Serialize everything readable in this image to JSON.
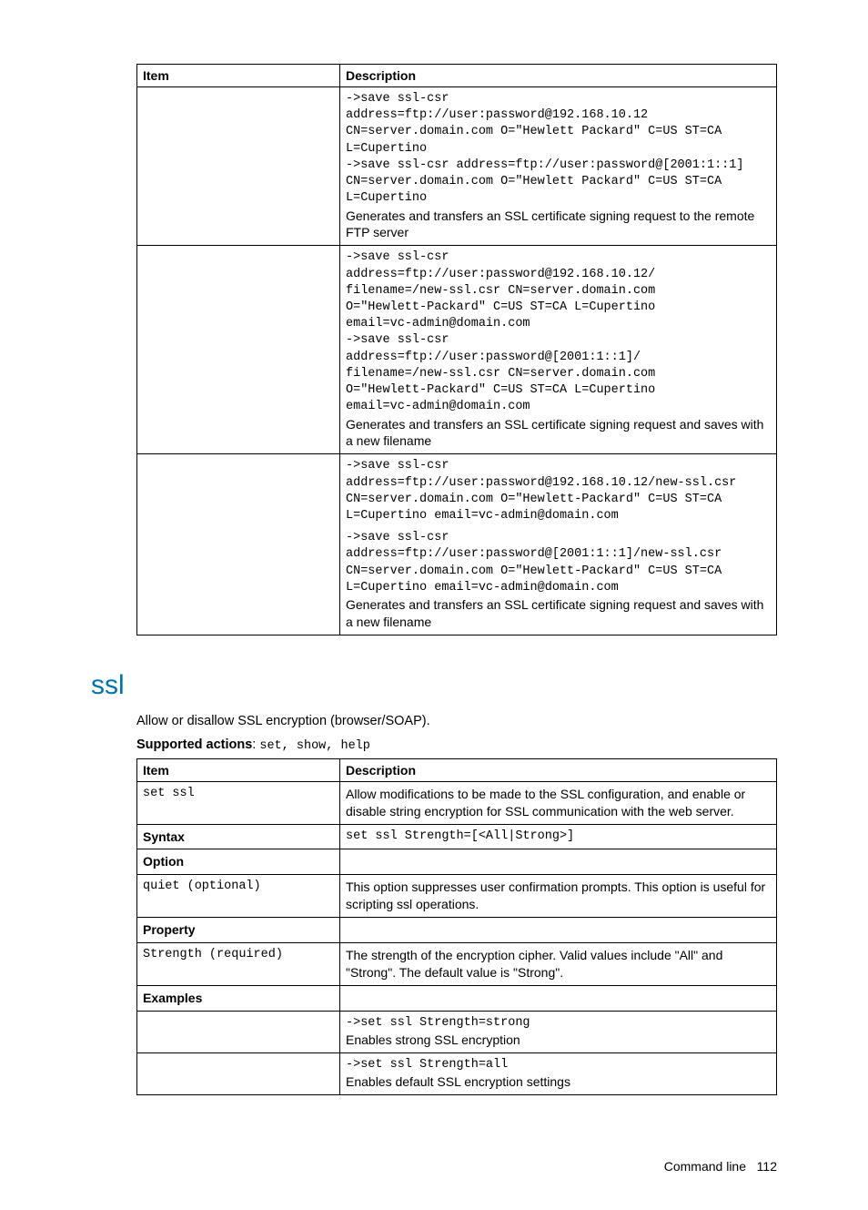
{
  "table1": {
    "headers": {
      "item": "Item",
      "desc": "Description"
    },
    "rows": [
      {
        "item": "",
        "code": "->save ssl-csr\naddress=ftp://user:password@192.168.10.12\nCN=server.domain.com O=\"Hewlett Packard\" C=US ST=CA L=Cupertino\n->save ssl-csr address=ftp://user:password@[2001:1::1]\nCN=server.domain.com O=\"Hewlett Packard\" C=US ST=CA L=Cupertino",
        "text": "Generates and transfers an SSL certificate signing request to the remote FTP server"
      },
      {
        "item": "",
        "code": "->save ssl-csr\naddress=ftp://user:password@192.168.10.12/\nfilename=/new-ssl.csr CN=server.domain.com\nO=\"Hewlett-Packard\" C=US ST=CA L=Cupertino\nemail=vc-admin@domain.com\n->save ssl-csr\naddress=ftp://user:password@[2001:1::1]/\nfilename=/new-ssl.csr CN=server.domain.com\nO=\"Hewlett-Packard\" C=US ST=CA L=Cupertino\nemail=vc-admin@domain.com",
        "text": "Generates and transfers an SSL certificate signing request and saves with a new filename"
      },
      {
        "item": "",
        "code1": "->save ssl-csr\naddress=ftp://user:password@192.168.10.12/new-ssl.csr\nCN=server.domain.com O=\"Hewlett-Packard\" C=US ST=CA L=Cupertino email=vc-admin@domain.com",
        "code2": "->save ssl-csr\naddress=ftp://user:password@[2001:1::1]/new-ssl.csr\nCN=server.domain.com O=\"Hewlett-Packard\" C=US ST=CA L=Cupertino email=vc-admin@domain.com",
        "text": "Generates and transfers an SSL certificate signing request and saves with a new filename"
      }
    ]
  },
  "section": {
    "title": "ssl",
    "intro": "Allow or disallow SSL encryption (browser/SOAP).",
    "supported_label": "Supported actions",
    "supported_value": "set, show, help"
  },
  "table2": {
    "headers": {
      "item": "Item",
      "desc": "Description"
    },
    "rows": {
      "r1_item": "set ssl",
      "r1_desc": "Allow modifications to be made to the SSL configuration, and enable or disable string encryption for SSL communication with the web server.",
      "r2_item": "Syntax",
      "r2_desc": "set ssl Strength=[<All|Strong>]",
      "r3_item": "Option",
      "r4_item": "quiet (optional)",
      "r4_desc": "This option suppresses user confirmation prompts. This option is useful for scripting ssl operations.",
      "r5_item": "Property",
      "r6_item": "Strength (required)",
      "r6_desc": "The strength of the encryption cipher. Valid values include \"All\" and \"Strong\". The default value is \"Strong\".",
      "r7_item": "Examples",
      "r8_code": "->set ssl Strength=strong",
      "r8_text": "Enables strong SSL encryption",
      "r9_code": "->set ssl Strength=all",
      "r9_text": "Enables default SSL encryption settings"
    }
  },
  "footer": {
    "label": "Command line",
    "page": "112"
  }
}
